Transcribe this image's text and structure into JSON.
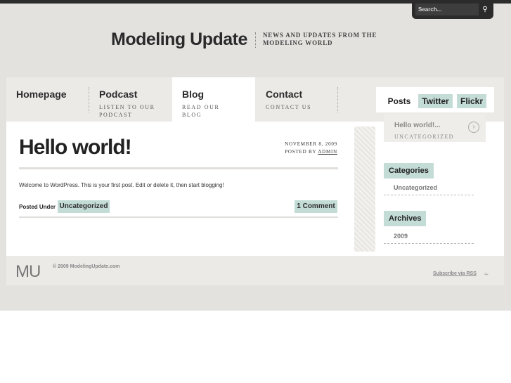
{
  "search": {
    "placeholder": "Search..."
  },
  "site": {
    "title": "Modeling Update",
    "tagline": "News and updates from the modeling world"
  },
  "nav": {
    "items": [
      {
        "label": "Homepage",
        "sub": ""
      },
      {
        "label": "Podcast",
        "sub": "Listen to our podcast"
      },
      {
        "label": "Blog",
        "sub": "Read our blog"
      },
      {
        "label": "Contact",
        "sub": "Contact us"
      }
    ]
  },
  "post": {
    "title": "Hello world!",
    "date": "November 8, 2009",
    "posted_by_prefix": "Posted by",
    "author": "admin",
    "body": "Welcome to WordPress. This is your first post. Edit or delete it, then start blogging!",
    "posted_under_label": "Posted Under",
    "category": "Uncategorized",
    "comments": "1 Comment"
  },
  "sidebar": {
    "tabs": [
      "Posts",
      "Twitter",
      "Flickr"
    ],
    "recent": {
      "title": "Hello world!...",
      "category": "Uncategorized"
    },
    "categories": {
      "heading": "Categories",
      "items": [
        "Uncategorized"
      ]
    },
    "archives": {
      "heading": "Archives",
      "items": [
        "2009"
      ]
    }
  },
  "footer": {
    "logo": "MU",
    "copyright": "© 2009 ModelingUpdate.com",
    "rss": "Subscribe via RSS"
  },
  "colors": {
    "accent": "#c4dcd6",
    "background": "#e3e2df",
    "topbar": "#2c2c2c"
  }
}
